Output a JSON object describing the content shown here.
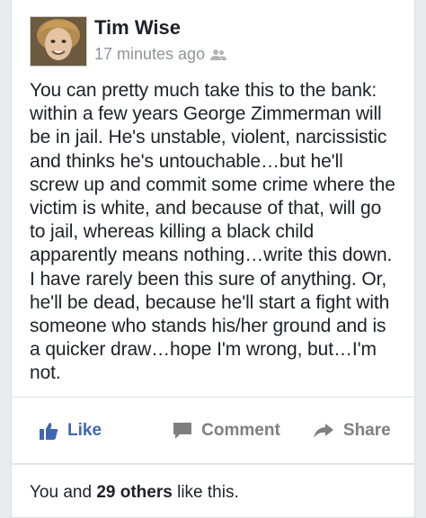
{
  "post": {
    "author": "Tim Wise",
    "timestamp": "17 minutes ago",
    "audience_icon": "friends-icon",
    "lines": [
      "You can pretty much take this to the bank:",
      "within a few years George Zimmerman will",
      "be in jail. He's unstable, violent, narcissistic",
      "and thinks he's untouchable…but he'll",
      "screw up and commit some crime where the",
      "victim is white, and because of that, will go",
      "to jail, whereas killing a black child",
      "apparently means nothing…write this down.",
      "I have rarely been this sure of anything. Or,",
      "he'll be dead, because he'll start a fight with",
      "someone who stands his/her ground and is",
      "a quicker draw…hope I'm wrong, but…I'm",
      "not."
    ]
  },
  "actions": {
    "like_label": "Like",
    "comment_label": "Comment",
    "share_label": "Share"
  },
  "likes": {
    "prefix": "You and",
    "count": "29 others",
    "suffix": "like this."
  },
  "colors": {
    "like_blue": "#4267b2",
    "text": "#1d2129",
    "muted": "#90949c"
  }
}
